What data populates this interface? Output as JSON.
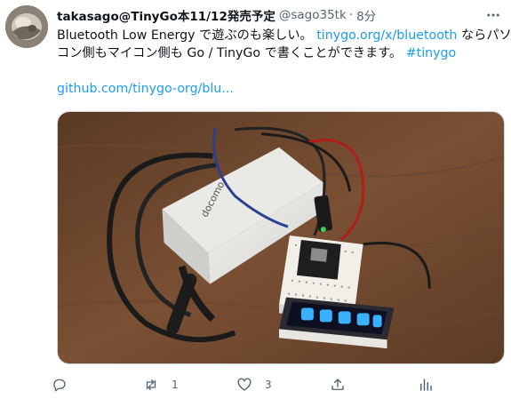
{
  "tweet": {
    "author": {
      "display_name": "takasago@TinyGo本11/12発売予定",
      "handle": "@sago35tk",
      "separator": "·",
      "time": "8分"
    },
    "text": {
      "part1": "Bluetooth Low Energy で遊ぶのも楽しい。",
      "link1": "tinygo.org/x/bluetooth",
      "part2": " ならパソ",
      "line2a": "コン側もマイコン側も Go / TinyGo で書くことができます。",
      "hashtag": "#tinygo",
      "link2": "github.com/tinygo-org/blu..."
    },
    "media": {
      "box_brand": "docomo"
    },
    "actions": {
      "reply_count": "",
      "retweet_count": "1",
      "like_count": "3"
    },
    "icons": {
      "more": "more-icon",
      "reply": "reply-icon",
      "retweet": "retweet-icon",
      "like": "heart-icon",
      "share": "share-icon",
      "analytics": "analytics-icon"
    },
    "colors": {
      "link": "#1d9bf0",
      "secondary_text": "#536471",
      "primary_text": "#0f1419"
    }
  }
}
